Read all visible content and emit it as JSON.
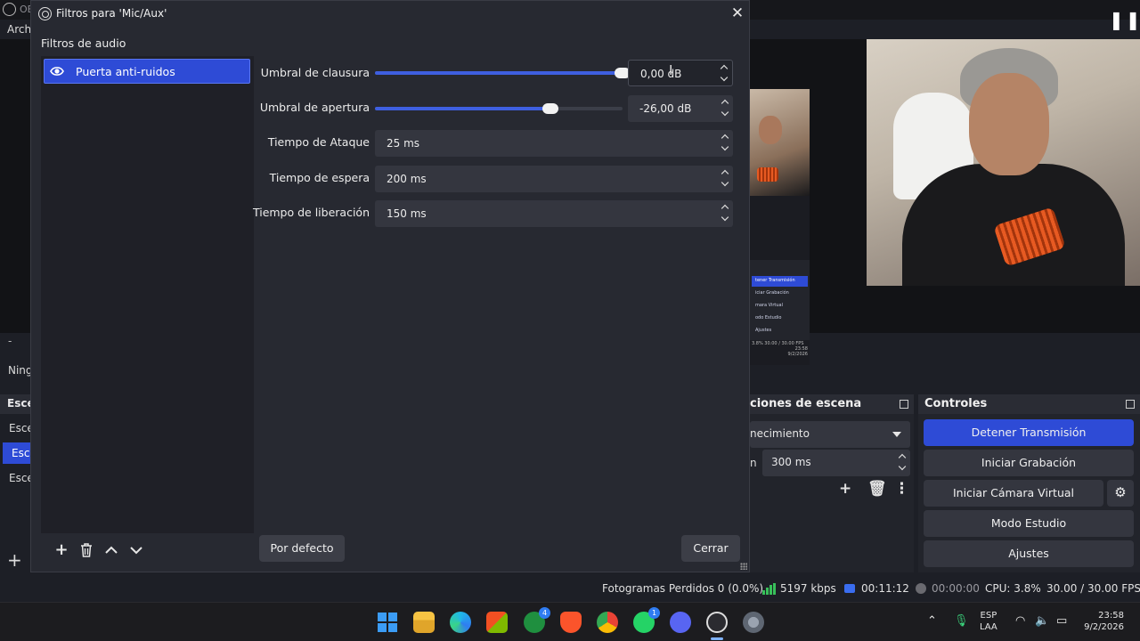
{
  "main_window": {
    "title": "OB",
    "menu_file": "Archi",
    "ninguna": "Ning",
    "dash": "-",
    "scenes_header": "Esce",
    "scenes": [
      "Esce",
      "Esce",
      "Esce"
    ],
    "transitions": {
      "header": "ciones de escena",
      "selected": "necimiento",
      "duration_label": "n",
      "duration": "300 ms"
    },
    "controls": {
      "header": "Controles",
      "stop_stream": "Detener Transmisión",
      "start_recording": "Iniciar Grabación",
      "start_virtual_cam": "Iniciar Cámara Virtual",
      "studio_mode": "Modo Estudio",
      "settings": "Ajustes"
    },
    "mini_preview": {
      "rows": [
        "tener Transmisión",
        "iciar Grabación",
        "mara Virtual",
        "odo Estudio",
        "Ajustes"
      ],
      "status": "3.8%  30.00 / 30.00 FPS",
      "clock": "23:58",
      "date": "9/2/2026"
    }
  },
  "status_bar": {
    "dropped_frames": "Fotogramas Perdidos 0 (0.0%)",
    "bitrate": "5197 kbps",
    "live_time": "00:11:12",
    "rec_time": "00:00:00",
    "cpu": "CPU: 3.8%",
    "fps": "30.00 / 30.00 FPS"
  },
  "dialog": {
    "title": "Filtros para 'Mic/Aux'",
    "section_label": "Filtros de audio",
    "filters": [
      {
        "name": "Puerta anti-ruidos",
        "visible": true
      }
    ],
    "properties": {
      "close_threshold": {
        "label": "Umbral de clausura",
        "value": "0,00 dB",
        "slider_fraction": 1.0
      },
      "open_threshold": {
        "label": "Umbral de apertura",
        "value": "-26,00 dB",
        "slider_fraction": 0.71
      },
      "attack_time": {
        "label": "Tiempo de Ataque",
        "value": "25 ms"
      },
      "hold_time": {
        "label": "Tiempo de espera",
        "value": "200 ms"
      },
      "release_time": {
        "label": "Tiempo de liberación",
        "value": "150 ms"
      }
    },
    "defaults_button": "Por defecto",
    "close_button": "Cerrar"
  },
  "taskbar": {
    "icons": [
      "windows-start",
      "file-explorer",
      "edge",
      "microsoft-store",
      "xbox",
      "brave",
      "chrome",
      "whatsapp",
      "discord",
      "obs",
      "settings"
    ],
    "xbox_badge": "4",
    "whatsapp_badge": "1",
    "lang_primary": "ESP",
    "lang_secondary": "LAA",
    "time": "23:58",
    "date": "9/2/2026"
  },
  "colors": {
    "accent": "#2e4bd6",
    "dialog_bg": "#272931",
    "input_bg": "#34363f"
  }
}
